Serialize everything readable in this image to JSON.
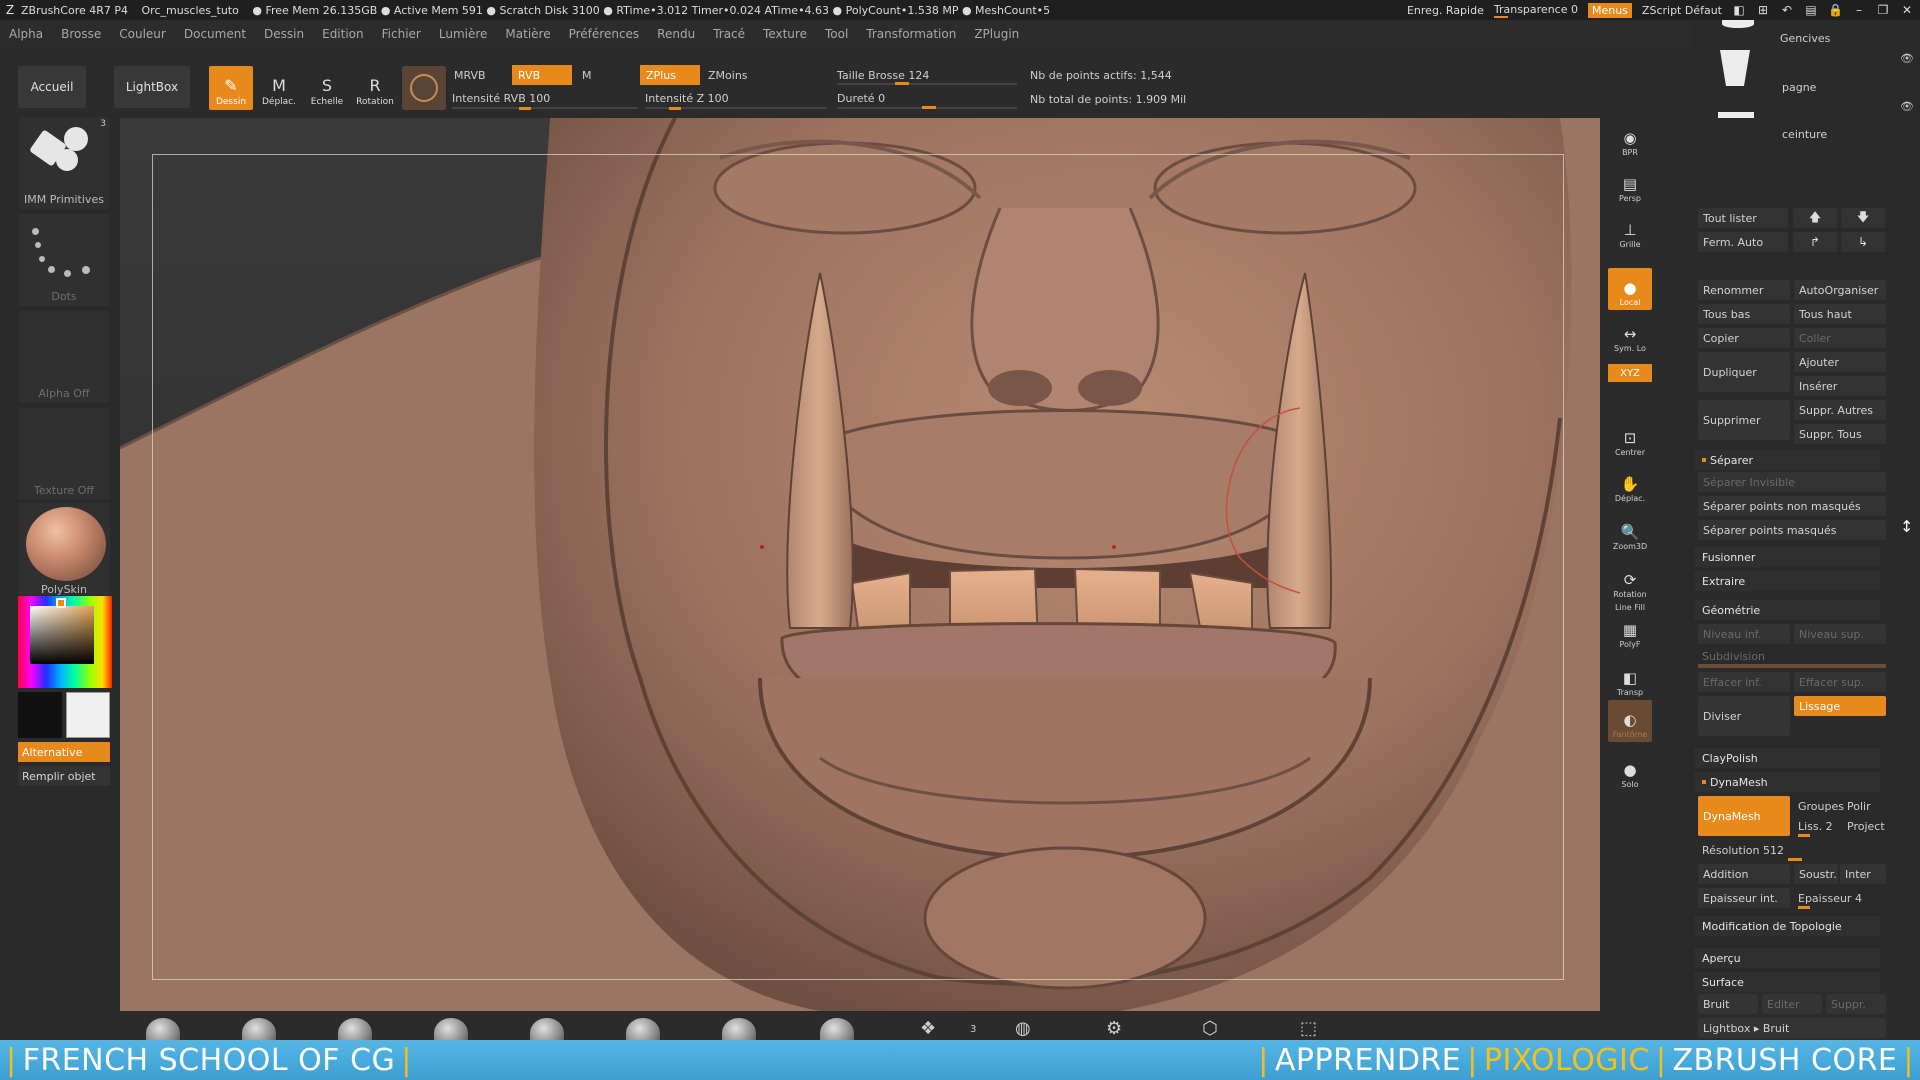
{
  "titlebar": {
    "app": "ZBrushCore 4R7 P4",
    "file": "Orc_muscles_tuto",
    "stats": "● Free Mem 26.135GB ● Active Mem 591 ● Scratch Disk 3100 ● RTime•3.012 Timer•0.024 ATime•4.63 ● PolyCount•1.538 MP ● MeshCount•5",
    "quick_save": "Enreg. Rapide",
    "transparency": "Transparence 0",
    "menus": "Menus",
    "zscript": "ZScript Défaut"
  },
  "menu": [
    "Alpha",
    "Brosse",
    "Couleur",
    "Document",
    "Dessin",
    "Edition",
    "Fichier",
    "Lumière",
    "Matière",
    "Préférences",
    "Rendu",
    "Tracé",
    "Texture",
    "Tool",
    "Transformation",
    "ZPlugin"
  ],
  "shelf": {
    "home": "Accueil",
    "lightbox": "LightBox",
    "tools": [
      {
        "label": "Dessin",
        "glyph": "✎",
        "active": true
      },
      {
        "label": "Déplac.",
        "glyph": "M",
        "active": false
      },
      {
        "label": "Echelle",
        "glyph": "S",
        "active": false
      },
      {
        "label": "Rotation",
        "glyph": "R",
        "active": false
      }
    ],
    "mrgb": "MRVB",
    "rgb": "RVB",
    "m": "M",
    "zadd": "ZPlus",
    "zsub": "ZMoins",
    "rgb_intensity": "Intensité RVB 100",
    "z_intensity": "Intensité Z 100",
    "brush_size": "Taille Brosse 124",
    "hardness": "Dureté 0",
    "active_points": "Nb de points actifs: 1,544",
    "total_points": "Nb total de points: 1.909 Mil",
    "brush_size_value": 124,
    "rgb_intensity_value": 100,
    "z_intensity_value": 100
  },
  "left": {
    "primitives": "IMM Primitives",
    "primitives_count": "3",
    "dots": "Dots",
    "alpha": "Alpha Off",
    "texture": "Texture Off",
    "material": "PolySkin",
    "alternative": "Alternative",
    "fill": "Remplir objet"
  },
  "rshelf": [
    {
      "label": "BPR",
      "glyph": "◉"
    },
    {
      "label": "Persp",
      "glyph": "▤"
    },
    {
      "label": "Grille",
      "glyph": "⊥"
    },
    {
      "label": "Local",
      "glyph": "●"
    },
    {
      "label": "Sym. Lo",
      "glyph": "↔"
    },
    {
      "label": "XYZ",
      "glyph": ""
    },
    {
      "label": "Centrer",
      "glyph": "⊡"
    },
    {
      "label": "Déplac.",
      "glyph": "✋"
    },
    {
      "label": "Zoom3D",
      "glyph": "🔍"
    },
    {
      "label": "Rotation",
      "glyph": "⟳"
    },
    {
      "label": "PolyF",
      "glyph": "▦"
    },
    {
      "label": "Transp",
      "glyph": "◧"
    },
    {
      "label": "Fantôme",
      "glyph": "◐"
    },
    {
      "label": "Solo",
      "glyph": "●"
    }
  ],
  "rshelf_linefill": "Line Fill",
  "subtools": [
    {
      "name": "Gencives"
    },
    {
      "name": "pagne"
    },
    {
      "name": "ceinture"
    }
  ],
  "rpanel": {
    "list_all": "Tout lister",
    "auto_collapse": "Ferm. Auto",
    "rename": "Renommer",
    "autoreorder": "AutoOrganiser",
    "all_low": "Tous bas",
    "all_high": "Tous haut",
    "copy": "Copier",
    "paste": "Coller",
    "duplicate": "Dupliquer",
    "append": "Ajouter",
    "insert": "Insérer",
    "delete": "Supprimer",
    "del_other": "Suppr. Autres",
    "del_all": "Suppr. Tous",
    "split": "Séparer",
    "split_hidden": "Séparer Invisible",
    "split_unmasked": "Séparer points non masqués",
    "split_masked": "Séparer points masqués",
    "merge": "Fusionner",
    "extract": "Extraire",
    "geometry": "Géométrie",
    "lower_res": "Niveau inf.",
    "higher_res": "Niveau sup.",
    "sdiv": "Subdivision",
    "del_lower": "Effacer inf.",
    "del_higher": "Effacer sup.",
    "divide": "Diviser",
    "smooth": "Lissage",
    "claypolish": "ClayPolish",
    "dynamesh_section": "DynaMesh",
    "dynamesh_btn": "DynaMesh",
    "groups": "Groupes",
    "polish": "Polir",
    "blur": "Liss. 2",
    "project": "Project",
    "resolution": "Résolution 512",
    "add": "Addition",
    "sub": "Soustr.",
    "inter": "Inter",
    "thickness_int": "Epaisseur int.",
    "thickness": "Epaisseur 4",
    "modify_topology": "Modification de Topologie",
    "preview": "Aperçu",
    "surface": "Surface",
    "noise": "Bruit",
    "edit": "Editer",
    "delete2": "Suppr.",
    "lightbox_brush": "Lightbox ▸ Bruit"
  },
  "bottom": {
    "count": "3"
  },
  "banner": {
    "left": "FRENCH SCHOOL OF CG",
    "learn": "APPRENDRE",
    "pixologic": "PIXOLOGIC",
    "zbrush": "ZBRUSH CORE"
  },
  "colors": {
    "accent": "#e8891b",
    "banner": "#4aa9dc",
    "banner_highlight": "#f2c11a",
    "clay": "#a57a62"
  }
}
